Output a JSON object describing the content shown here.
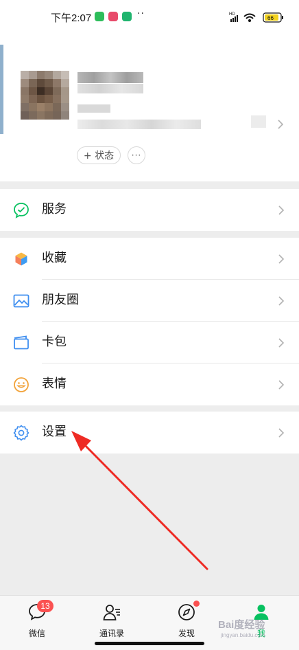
{
  "status_bar": {
    "time": "下午2:07",
    "dots": "··",
    "network": "HD",
    "battery": "66"
  },
  "profile": {
    "status_button_label": "+ 状态",
    "more_label": "···"
  },
  "menu": {
    "group1": [
      {
        "label": "服务",
        "icon": "service-icon"
      }
    ],
    "group2": [
      {
        "label": "收藏",
        "icon": "favorites-icon"
      },
      {
        "label": "朋友圈",
        "icon": "moments-icon"
      },
      {
        "label": "卡包",
        "icon": "card-wallet-icon"
      },
      {
        "label": "表情",
        "icon": "sticker-icon"
      }
    ],
    "group3": [
      {
        "label": "设置",
        "icon": "settings-icon"
      }
    ]
  },
  "tabbar": {
    "tabs": [
      {
        "label": "微信",
        "icon": "chat-icon",
        "badge": "13"
      },
      {
        "label": "通讯录",
        "icon": "contacts-icon"
      },
      {
        "label": "发现",
        "icon": "discover-icon"
      },
      {
        "label": "我",
        "icon": "me-icon",
        "active": true
      }
    ]
  },
  "watermark": {
    "text": "Bai度经验",
    "sub": "jingyan.baidu.com"
  },
  "colors": {
    "accent": "#07c160",
    "badge": "#fa5151",
    "annotation_arrow": "#ee2b24",
    "background": "#ededed"
  }
}
